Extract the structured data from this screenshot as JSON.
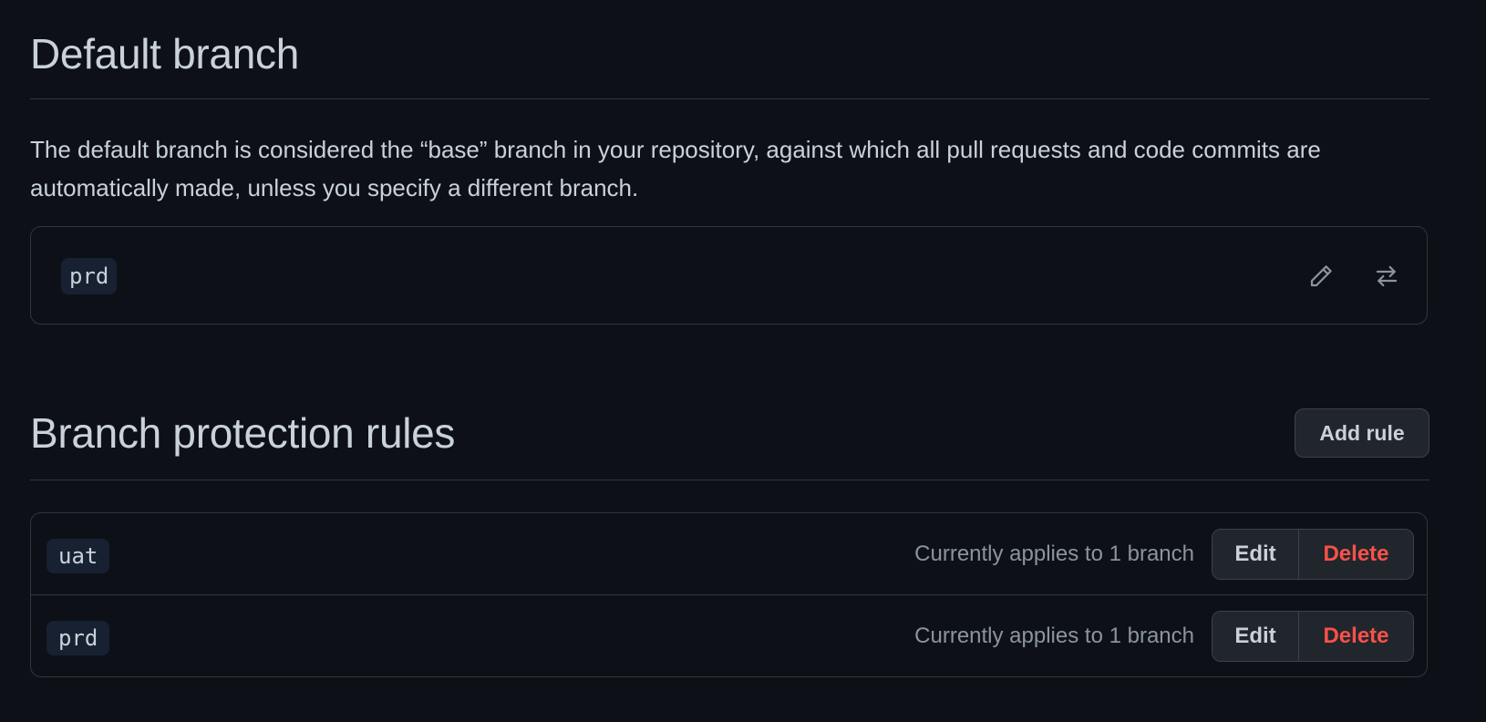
{
  "default_branch": {
    "title": "Default branch",
    "description": "The default branch is considered the “base” branch in your repository, against which all pull requests and code commits are automatically made, unless you specify a different branch.",
    "branch_name": "prd",
    "icons": {
      "rename": "pencil-icon",
      "switch": "arrow-switch-icon"
    }
  },
  "protection_rules": {
    "title": "Branch protection rules",
    "add_rule_label": "Add rule",
    "rules": [
      {
        "pattern": "uat",
        "applies_text": "Currently applies to 1 branch",
        "edit_label": "Edit",
        "delete_label": "Delete"
      },
      {
        "pattern": "prd",
        "applies_text": "Currently applies to 1 branch",
        "edit_label": "Edit",
        "delete_label": "Delete"
      }
    ]
  },
  "colors": {
    "background": "#0d1117",
    "border": "#30363d",
    "text": "#c9d1d9",
    "muted_text": "#8b949e",
    "danger": "#f85149",
    "tag_background": "#172132"
  }
}
